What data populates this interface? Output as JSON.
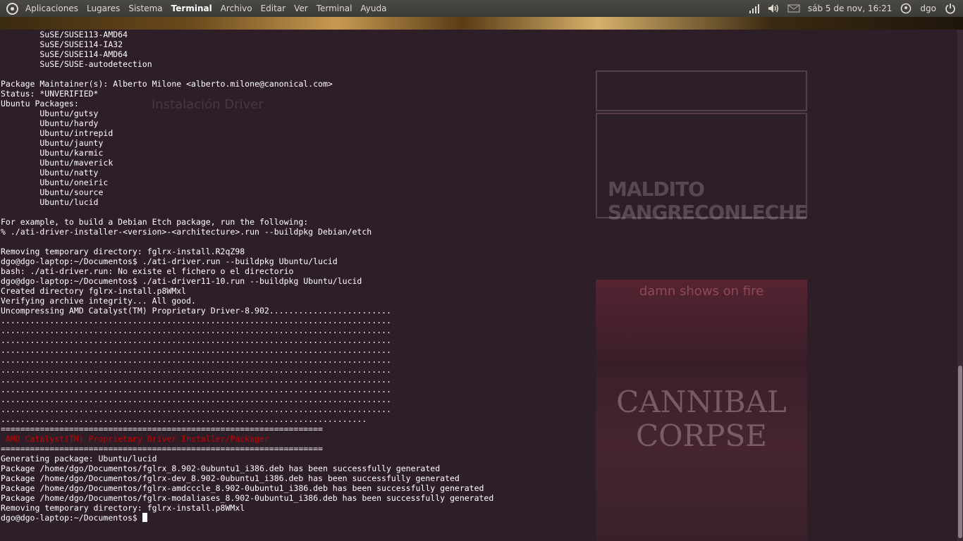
{
  "top_panel": {
    "menus": [
      "Aplicaciones",
      "Lugares",
      "Sistema"
    ],
    "app_name": "Terminal",
    "app_menus": [
      "Archivo",
      "Editar",
      "Ver",
      "Terminal",
      "Ayuda"
    ],
    "datetime": "sáb 5 de nov, 16:21",
    "user": "dgo",
    "icons": {
      "ubuntu": "ubuntu-logo-icon",
      "network": "signal-bars-icon",
      "volume": "volume-icon",
      "mail": "envelope-icon",
      "user": "user-icon",
      "power": "power-icon"
    }
  },
  "background_page": {
    "heading": "Instalación Driver",
    "sidebar_logo_line1": "MALDITO",
    "sidebar_logo_line2": "SANGRECONLECHE",
    "poster_title": "damn shows on fire",
    "poster_band_line1": "CANNIBAL",
    "poster_band_line2": "CORPSE"
  },
  "terminal": {
    "lines_top": [
      "        SuSE/SUSE113-AMD64",
      "        SuSE/SUSE114-IA32",
      "        SuSE/SUSE114-AMD64",
      "        SuSE/SUSE-autodetection",
      "",
      "Package Maintainer(s): Alberto Milone <alberto.milone@canonical.com>",
      "Status: *UNVERIFIED*",
      "Ubuntu Packages:",
      "        Ubuntu/gutsy",
      "        Ubuntu/hardy",
      "        Ubuntu/intrepid",
      "        Ubuntu/jaunty",
      "        Ubuntu/karmic",
      "        Ubuntu/maverick",
      "        Ubuntu/natty",
      "        Ubuntu/oneiric",
      "        Ubuntu/source",
      "        Ubuntu/lucid",
      "",
      "For example, to build a Debian Etch package, run the following:",
      "% ./ati-driver-installer-<version>-<architecture>.run --buildpkg Debian/etch",
      "",
      "Removing temporary directory: fglrx-install.R2qZ98",
      "dgo@dgo-laptop:~/Documentos$ ./ati-driver.run --buildpkg Ubuntu/lucid",
      "bash: ./ati-driver.run: No existe el fichero o el directorio",
      "dgo@dgo-laptop:~/Documentos$ ./ati-driver11-10.run --buildpkg Ubuntu/lucid",
      "Created directory fglrx-install.p8WMxl",
      "Verifying archive integrity... All good.",
      "Uncompressing AMD Catalyst(TM) Proprietary Driver-8.902.........................",
      "................................................................................",
      "................................................................................",
      "................................................................................",
      "................................................................................",
      "................................................................................",
      "................................................................................",
      "................................................................................",
      "................................................................................",
      "................................................................................",
      "................................................................................",
      "...........................................................................",
      "=================================================================="
    ],
    "installer_title": " AMD Catalyst(TM) Proprietary Driver Installer/Packager",
    "lines_bottom": [
      "==================================================================",
      "Generating package: Ubuntu/lucid",
      "Package /home/dgo/Documentos/fglrx_8.902-0ubuntu1_i386.deb has been successfully generated",
      "Package /home/dgo/Documentos/fglrx-dev_8.902-0ubuntu1_i386.deb has been successfully generated",
      "Package /home/dgo/Documentos/fglrx-amdcccle_8.902-0ubuntu1_i386.deb has been successfully generated",
      "Package /home/dgo/Documentos/fglrx-modaliases_8.902-0ubuntu1_i386.deb has been successfully generated",
      "Removing temporary directory: fglrx-install.p8WMxl"
    ],
    "prompt": "dgo@dgo-laptop:~/Documentos$ ",
    "colors": {
      "background": "#2d1e28",
      "foreground": "#ffffff",
      "highlight": "#cc0000"
    }
  }
}
